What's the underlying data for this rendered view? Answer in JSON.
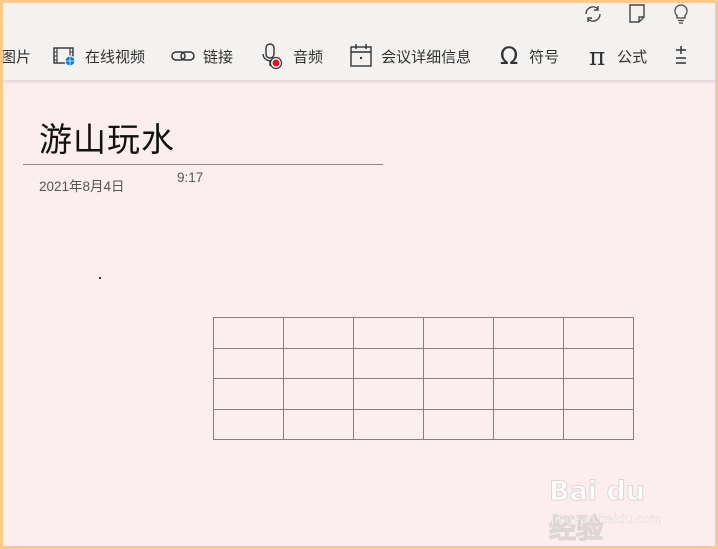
{
  "toolbar": {
    "items": [
      {
        "label": "图片",
        "icon": "picture-icon"
      },
      {
        "label": "在线视频",
        "icon": "online-video-icon"
      },
      {
        "label": "链接",
        "icon": "link-icon"
      },
      {
        "label": "音频",
        "icon": "audio-icon"
      },
      {
        "label": "会议详细信息",
        "icon": "meeting-details-icon"
      },
      {
        "label": "符号",
        "icon": "symbol-icon"
      },
      {
        "label": "公式",
        "icon": "equation-icon"
      }
    ],
    "top_icons": [
      "sync-icon",
      "page-icon",
      "lightbulb-icon"
    ]
  },
  "page": {
    "title": "游山玩水",
    "date": "2021年8月4日",
    "time": "9:17"
  },
  "table": {
    "rows": [
      [
        "",
        "",
        "",
        "",
        "",
        ""
      ],
      [
        "",
        "",
        "",
        "",
        "",
        ""
      ],
      [
        "",
        "",
        "",
        "",
        "",
        ""
      ],
      [
        "",
        "",
        "",
        "",
        "",
        ""
      ]
    ]
  },
  "watermark": {
    "logo": "Bai du 经验",
    "url": "jingyan.baidu.com"
  },
  "colors": {
    "page_background": "#fcedef",
    "ribbon_background": "#f3f2f1",
    "frame_border": "#fbc98a",
    "record_red": "#e81123",
    "globe_blue": "#0078d4"
  }
}
